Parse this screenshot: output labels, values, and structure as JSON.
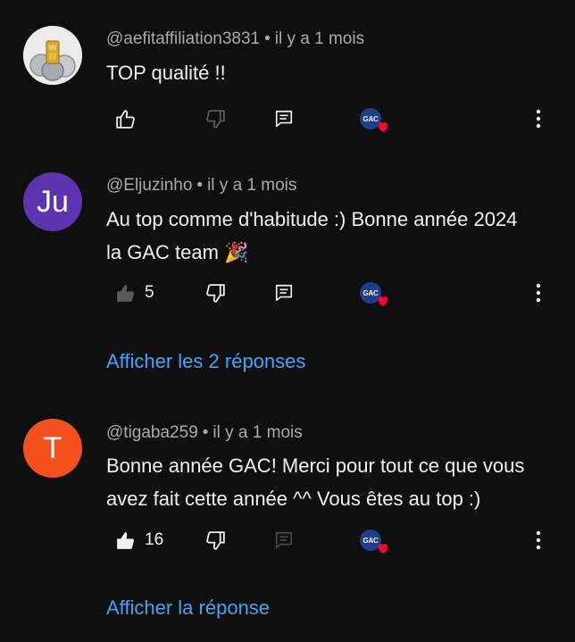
{
  "comments": [
    {
      "author": "@aefitaffiliation3831",
      "time": "il y a 1 mois",
      "text_lines": [
        "TOP qualité !!"
      ],
      "likes": "",
      "avatar": {
        "type": "image",
        "icon": "gold-coins-avatar-image"
      },
      "separator": "•"
    },
    {
      "author": "@Eljuzinho",
      "time": "il y a 1 mois",
      "text_lines": [
        "Au top comme d'habitude :) Bonne année 2024",
        "la GAC team 🎉"
      ],
      "likes": "5",
      "avatar": {
        "type": "initials",
        "initials": "Ju",
        "color": "#5e35b1"
      },
      "replies_label": "Afficher les 2 réponses",
      "separator": "•"
    },
    {
      "author": "@tigaba259",
      "time": "il y a 1 mois",
      "text_lines": [
        "Bonne année GAC! Merci pour tout ce que vous",
        "avez fait cette année ^^ Vous êtes au top :)"
      ],
      "likes": "16",
      "avatar": {
        "type": "initials",
        "initials": "T",
        "color": "#f4511e"
      },
      "replies_label": "Afficher la réponse",
      "separator": "•"
    }
  ],
  "creator_badge": {
    "text": "GAC",
    "heart_color": "#ff0033",
    "badge_color": "#1b3f8a"
  },
  "colors": {
    "background": "#0f0f0f",
    "link": "#3ea6ff",
    "meta": "#aaaaaa",
    "text": "#f1f1f1"
  },
  "icons": [
    "thumb-up-icon",
    "thumb-down-icon",
    "reply-icon",
    "more-vert-icon",
    "heart-icon"
  ]
}
